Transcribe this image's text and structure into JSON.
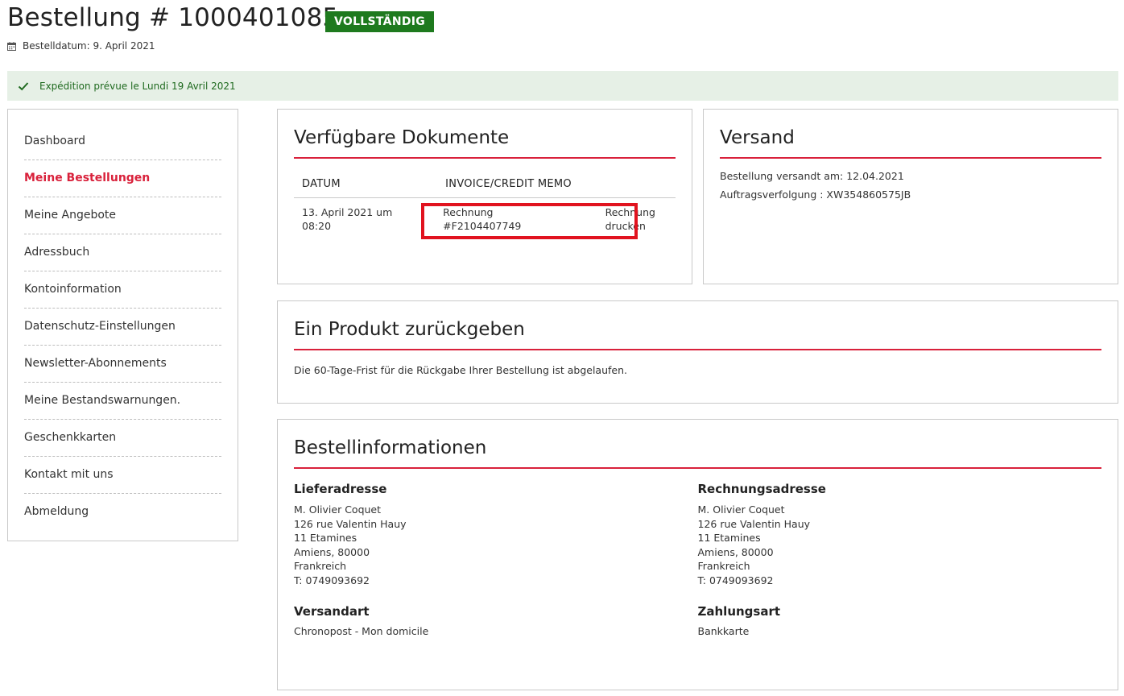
{
  "header": {
    "order_title": "Bestellung # 1000401085",
    "status": "VOLLSTÄNDIG",
    "order_date": "Bestelldatum: 9. April 2021"
  },
  "notice": {
    "text": "Expédition prévue le Lundi 19 Avril 2021"
  },
  "sidebar": {
    "items": [
      {
        "label": "Dashboard"
      },
      {
        "label": "Meine Bestellungen"
      },
      {
        "label": "Meine Angebote"
      },
      {
        "label": "Adressbuch"
      },
      {
        "label": "Kontoinformation"
      },
      {
        "label": "Datenschutz-Einstellungen"
      },
      {
        "label": "Newsletter-Abonnements"
      },
      {
        "label": "Meine Bestandswarnungen."
      },
      {
        "label": "Geschenkkarten"
      },
      {
        "label": "Kontakt mit uns"
      },
      {
        "label": "Abmeldung"
      }
    ],
    "active_item": "Meine Bestellungen"
  },
  "documents": {
    "title": "Verfügbare Dokumente",
    "columns": [
      "DATUM",
      "INVOICE/CREDIT MEMO"
    ],
    "rows": [
      {
        "date_line1": "13. April 2021 um",
        "date_line2": "08:20",
        "name_line1": "Rechnung",
        "name_line2": "#F2104407749",
        "action_line1": "Rechnung",
        "action_line2": "drucken"
      }
    ]
  },
  "shipping": {
    "title": "Versand",
    "shipped_on": "Bestellung versandt am: 12.04.2021",
    "tracking": "Auftragsverfolgung : XW354860575JB"
  },
  "return": {
    "title": "Ein Produkt zurückgeben",
    "text": "Die 60-Tage-Frist für die Rückgabe Ihrer Bestellung ist abgelaufen."
  },
  "order_info": {
    "title": "Bestellinformationen",
    "shipping_address": {
      "heading": "Lieferadresse",
      "lines": [
        "M. Olivier Coquet",
        "126 rue Valentin Hauy",
        "11 Etamines",
        "Amiens, 80000",
        "Frankreich",
        "T: 0749093692"
      ]
    },
    "billing_address": {
      "heading": "Rechnungsadresse",
      "lines": [
        "M. Olivier Coquet",
        "126 rue Valentin Hauy",
        "11 Etamines",
        "Amiens, 80000",
        "Frankreich",
        "T: 0749093692"
      ]
    },
    "shipping_method": {
      "heading": "Versandart",
      "value": "Chronopost - Mon domicile"
    },
    "payment_method": {
      "heading": "Zahlungsart",
      "value": "Bankkarte"
    }
  },
  "colors": {
    "accent_red": "#d9213b",
    "status_green": "#1e7a1e",
    "notice_bg": "#e6f0e6",
    "highlight_red": "#e1131f"
  }
}
